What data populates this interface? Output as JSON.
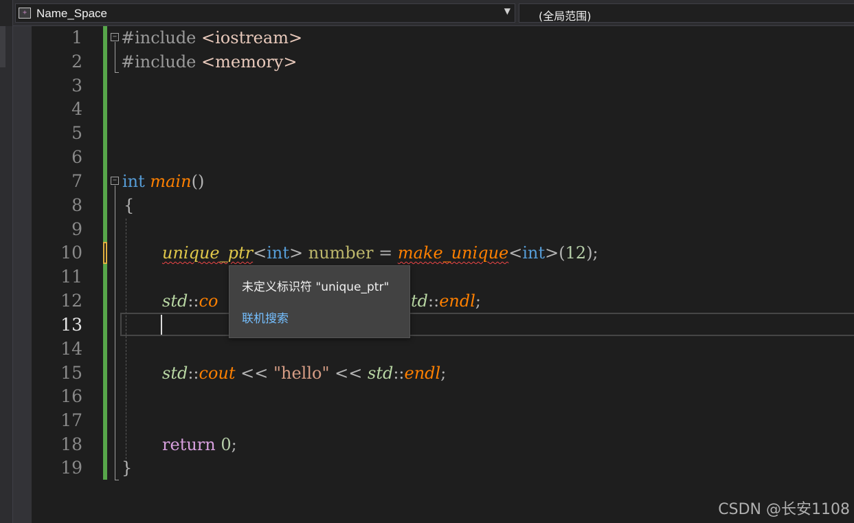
{
  "navbar": {
    "project_scope": "Name_Space",
    "project_icon": "class-cube-icon",
    "global_scope": "(全局范围)"
  },
  "line_numbers": [
    "1",
    "2",
    "3",
    "4",
    "5",
    "6",
    "7",
    "8",
    "9",
    "10",
    "11",
    "12",
    "13",
    "14",
    "15",
    "16",
    "17",
    "18",
    "19"
  ],
  "active_line": "13",
  "code": {
    "l1_a": "#include ",
    "l1_b": "<iostream>",
    "l2_a": "#include ",
    "l2_b": "<memory>",
    "l7_kw": "int",
    "l7_fn": "main",
    "l7_p": "()",
    "l8": "{",
    "l10_tpl": "unique_ptr",
    "l10_a": "<",
    "l10_int": "int",
    "l10_b": "> ",
    "l10_var": "number",
    "l10_c": " = ",
    "l10_fn": "make_unique",
    "l10_d": "<",
    "l10_int2": "int",
    "l10_e": ">(",
    "l10_num": "12",
    "l10_f": ");",
    "l12_ns": "std",
    "l12_a": "::",
    "l12_fn": "co",
    "l12_ns2": "td",
    "l12_b": "::",
    "l12_fn2": "endl",
    "l12_c": ";",
    "l15_ns": "std",
    "l15_a": "::",
    "l15_fn": "cout",
    "l15_b": " << ",
    "l15_str": "\"hello\"",
    "l15_c": " << ",
    "l15_ns2": "std",
    "l15_d": "::",
    "l15_fn2": "endl",
    "l15_e": ";",
    "l18_kw": "return",
    "l18_sp": " ",
    "l18_num": "0",
    "l18_p": ";",
    "l19": "}"
  },
  "tooltip": {
    "message": "未定义标识符 \"unique_ptr\"",
    "link": "联机搜索"
  },
  "watermark": "CSDN @长安1108",
  "colors": {
    "background": "#1e1e1e",
    "keyword": "#569cd6",
    "function": "#ff8000",
    "change_bar": "#57a64a",
    "error_squiggle": "#f44747",
    "link": "#75bfff"
  }
}
